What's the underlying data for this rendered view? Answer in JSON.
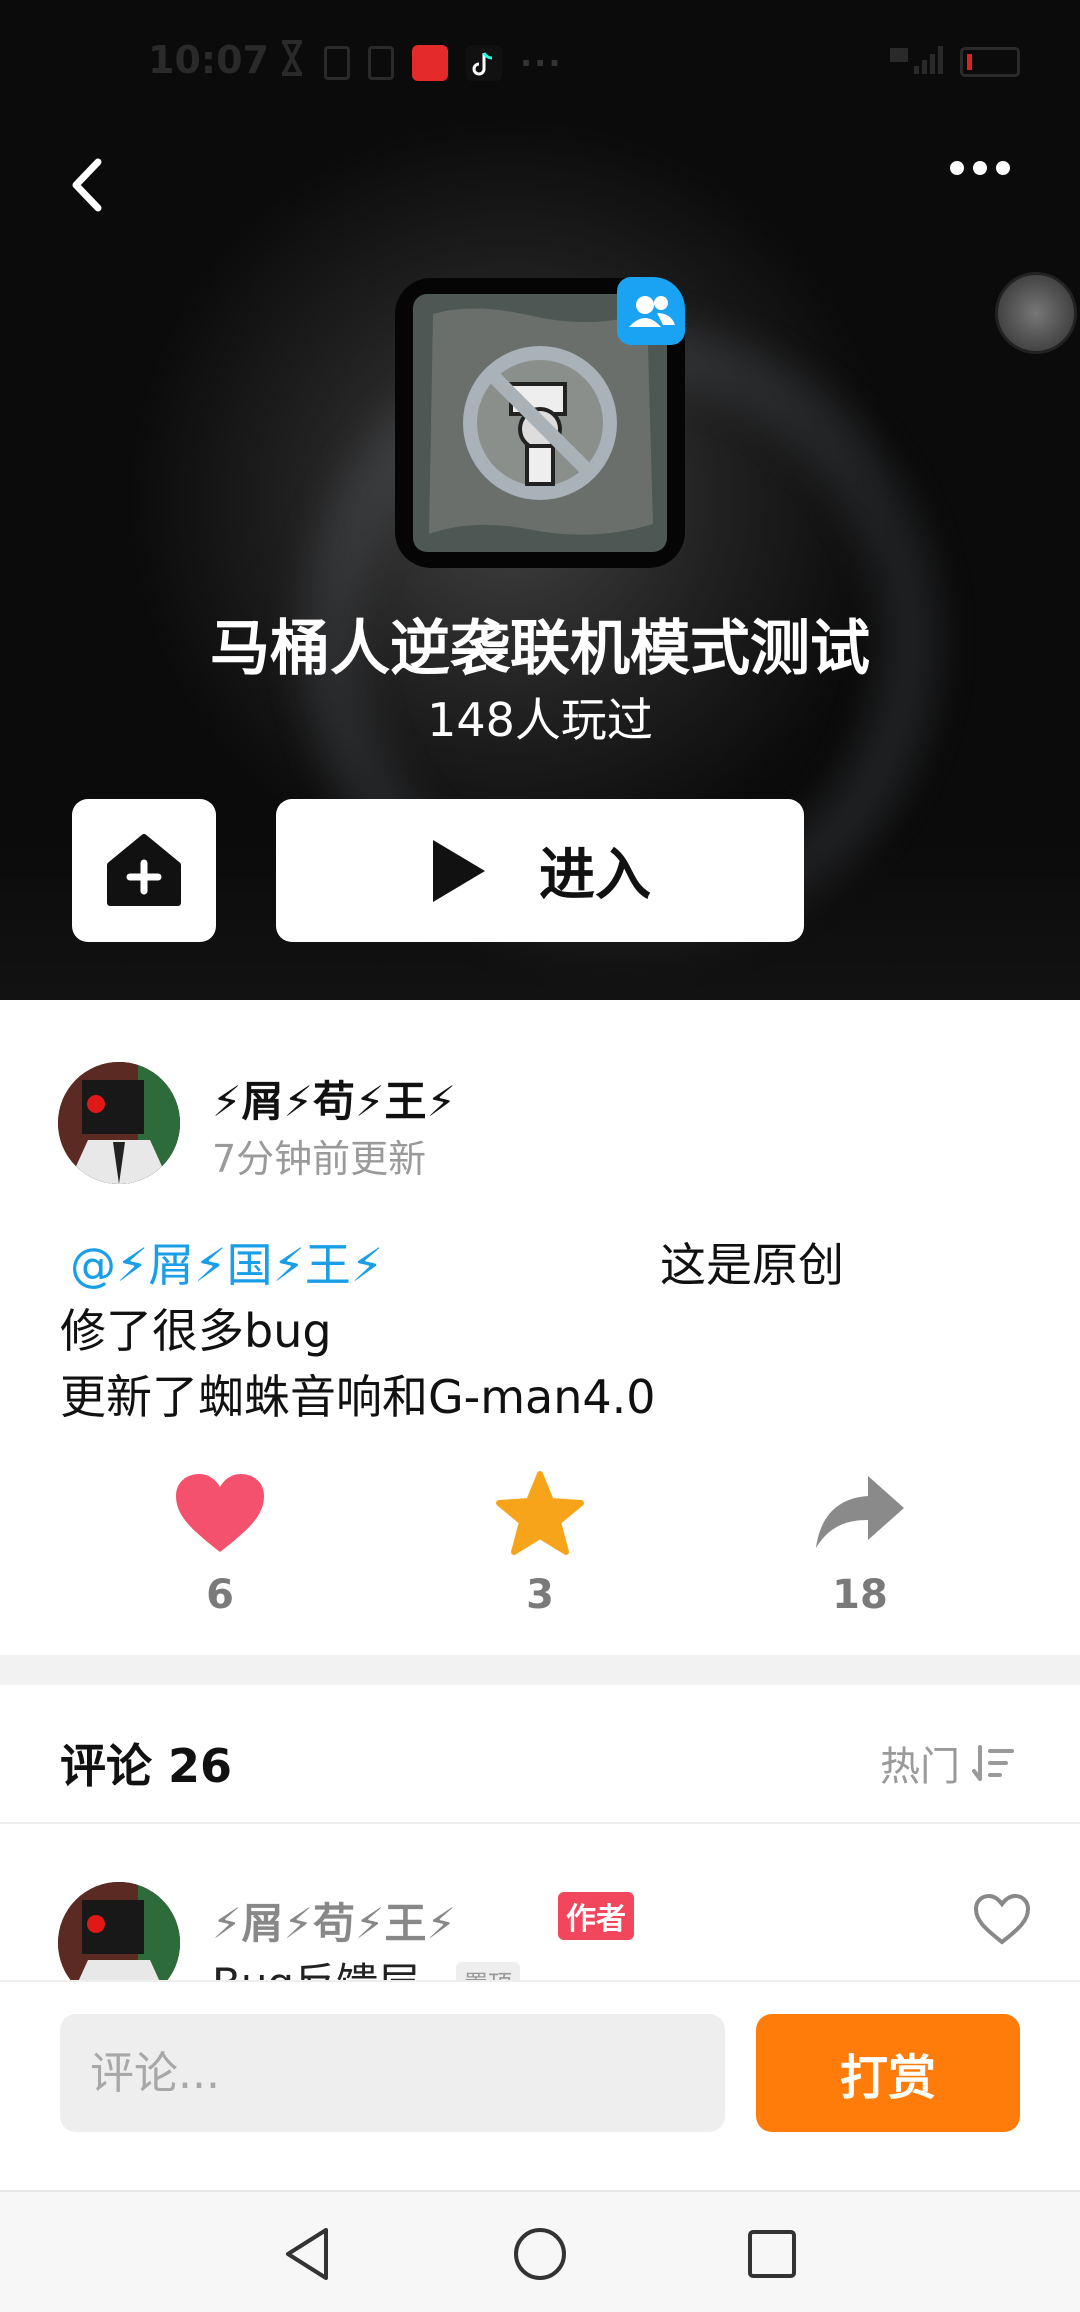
{
  "status_bar": {
    "time": "10:07"
  },
  "header": {
    "title": "马桶人逆袭联机模式测试",
    "play_count": "148人玩过",
    "enter_label": "进入"
  },
  "post": {
    "author": "⚡屑⚡苟⚡王⚡",
    "updated": "7分钟前更新",
    "mention": "@⚡屑⚡国⚡王⚡",
    "original": "这是原创",
    "line2": "修了很多bug",
    "line3": "更新了蜘蛛音响和G-man4.0",
    "likes": "6",
    "favorites": "3",
    "shares": "18",
    "colors": {
      "like": "#f4516c",
      "favorite": "#f7a41b",
      "share": "#8a8a8a",
      "mention": "#1a9ee8"
    }
  },
  "comments": {
    "title": "评论 26",
    "sort_label": "热门",
    "first": {
      "author": "⚡屑⚡苟⚡王⚡",
      "author_tag": "作者",
      "text": "Bug反馈层",
      "pin_tag": "置顶"
    }
  },
  "bottom": {
    "input_placeholder": "评论...",
    "reward_label": "打赏"
  },
  "nav": {
    "icons": [
      "back-triangle-icon",
      "home-circle-icon",
      "recents-square-icon"
    ]
  }
}
